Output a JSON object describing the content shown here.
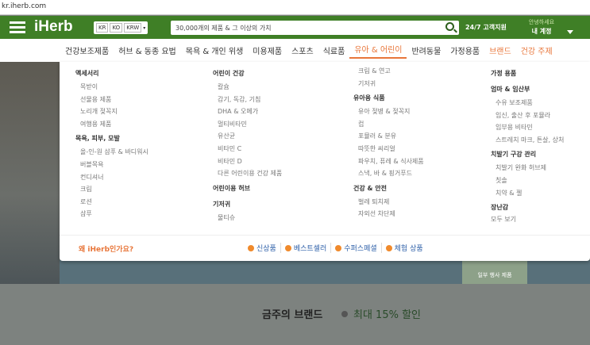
{
  "url": "kr.iherb.com",
  "header": {
    "logo": "iHerb",
    "country": "KR",
    "language": "KO",
    "currency": "KRW",
    "search_placeholder": "30,000개의 제품 & 그 이상의 가치",
    "support": "24/7 고객지원",
    "account_greeting": "안녕하세요",
    "account": "내 계정"
  },
  "nav": [
    "건강보조제품",
    "허브 & 동종 요법",
    "목욕 & 개인 위생",
    "미용제품",
    "스포츠",
    "식료품",
    "유아 & 어린이",
    "반려동물",
    "가정용품",
    "브랜드",
    "건강 주제"
  ],
  "menu": {
    "col1": [
      {
        "h": "액세서리"
      },
      {
        "i": "목받이"
      },
      {
        "i": "선물용 제품"
      },
      {
        "i": "노리개 젖꼭지"
      },
      {
        "i": "여행용 제품"
      },
      {
        "h": "목욕, 피부, 모발"
      },
      {
        "i": "올-인-원 샴푸 & 바디워시"
      },
      {
        "i": "버블목욕"
      },
      {
        "i": "컨디셔너"
      },
      {
        "i": "크림"
      },
      {
        "i": "로션"
      },
      {
        "i": "샴푸"
      }
    ],
    "col2": [
      {
        "h": "어린이 건강"
      },
      {
        "i": "칼슘"
      },
      {
        "i": "감기, 독감, 기침"
      },
      {
        "i": "DHA & 오메가"
      },
      {
        "i": "멀티비타민"
      },
      {
        "i": "유산균"
      },
      {
        "i": "비타민 C"
      },
      {
        "i": "비타민 D"
      },
      {
        "i": "다른 어린이용 건강 제품"
      },
      {
        "h": "어린이용 허브"
      },
      {
        "h": "기저귀"
      },
      {
        "i": "물티슈"
      }
    ],
    "col3": [
      {
        "i": "크림 & 연고"
      },
      {
        "i": "기저귀"
      },
      {
        "h": "유아용 식품"
      },
      {
        "i": "유아 젖병 & 젖꼭지"
      },
      {
        "i": "컵"
      },
      {
        "i": "포뮬러 & 분유"
      },
      {
        "i": "따뜻한 씨리얼"
      },
      {
        "i": "파우치, 퓨레 & 식사제품"
      },
      {
        "i": "스낵, 바 & 핑거푸드"
      },
      {
        "h": "건강 & 안전"
      },
      {
        "i": "벌레 퇴치제"
      },
      {
        "i": "자외선 차단제"
      }
    ],
    "col4": [
      {
        "h": "가정 용품"
      },
      {
        "h": "엄마 & 임산부"
      },
      {
        "i": "수유 보조제품"
      },
      {
        "i": "임신, 출산 후 포뮬라"
      },
      {
        "i": "임부용 비타민"
      },
      {
        "i": "스트레치 마크, 튼살, 상처"
      },
      {
        "h": "치발기 구강 관리"
      },
      {
        "i": "치발기 완화 허브제"
      },
      {
        "i": "칫솔"
      },
      {
        "i": "치약 & 젤"
      },
      {
        "h": "장난감"
      },
      {
        "a": "모두 보기"
      }
    ]
  },
  "footer": {
    "why": "왜 iHerb인가요?",
    "links": [
      "신상품",
      "베스트셀러",
      "수퍼스페셜",
      "체험 상품"
    ]
  },
  "promo": "일부 행사 제품",
  "brand": {
    "title": "금주의 브랜드",
    "sub": "최대 15% 할인"
  },
  "colors": {
    "green": "#3f7f26",
    "orange": "#e8763a",
    "blue": "#2d5fa8"
  }
}
